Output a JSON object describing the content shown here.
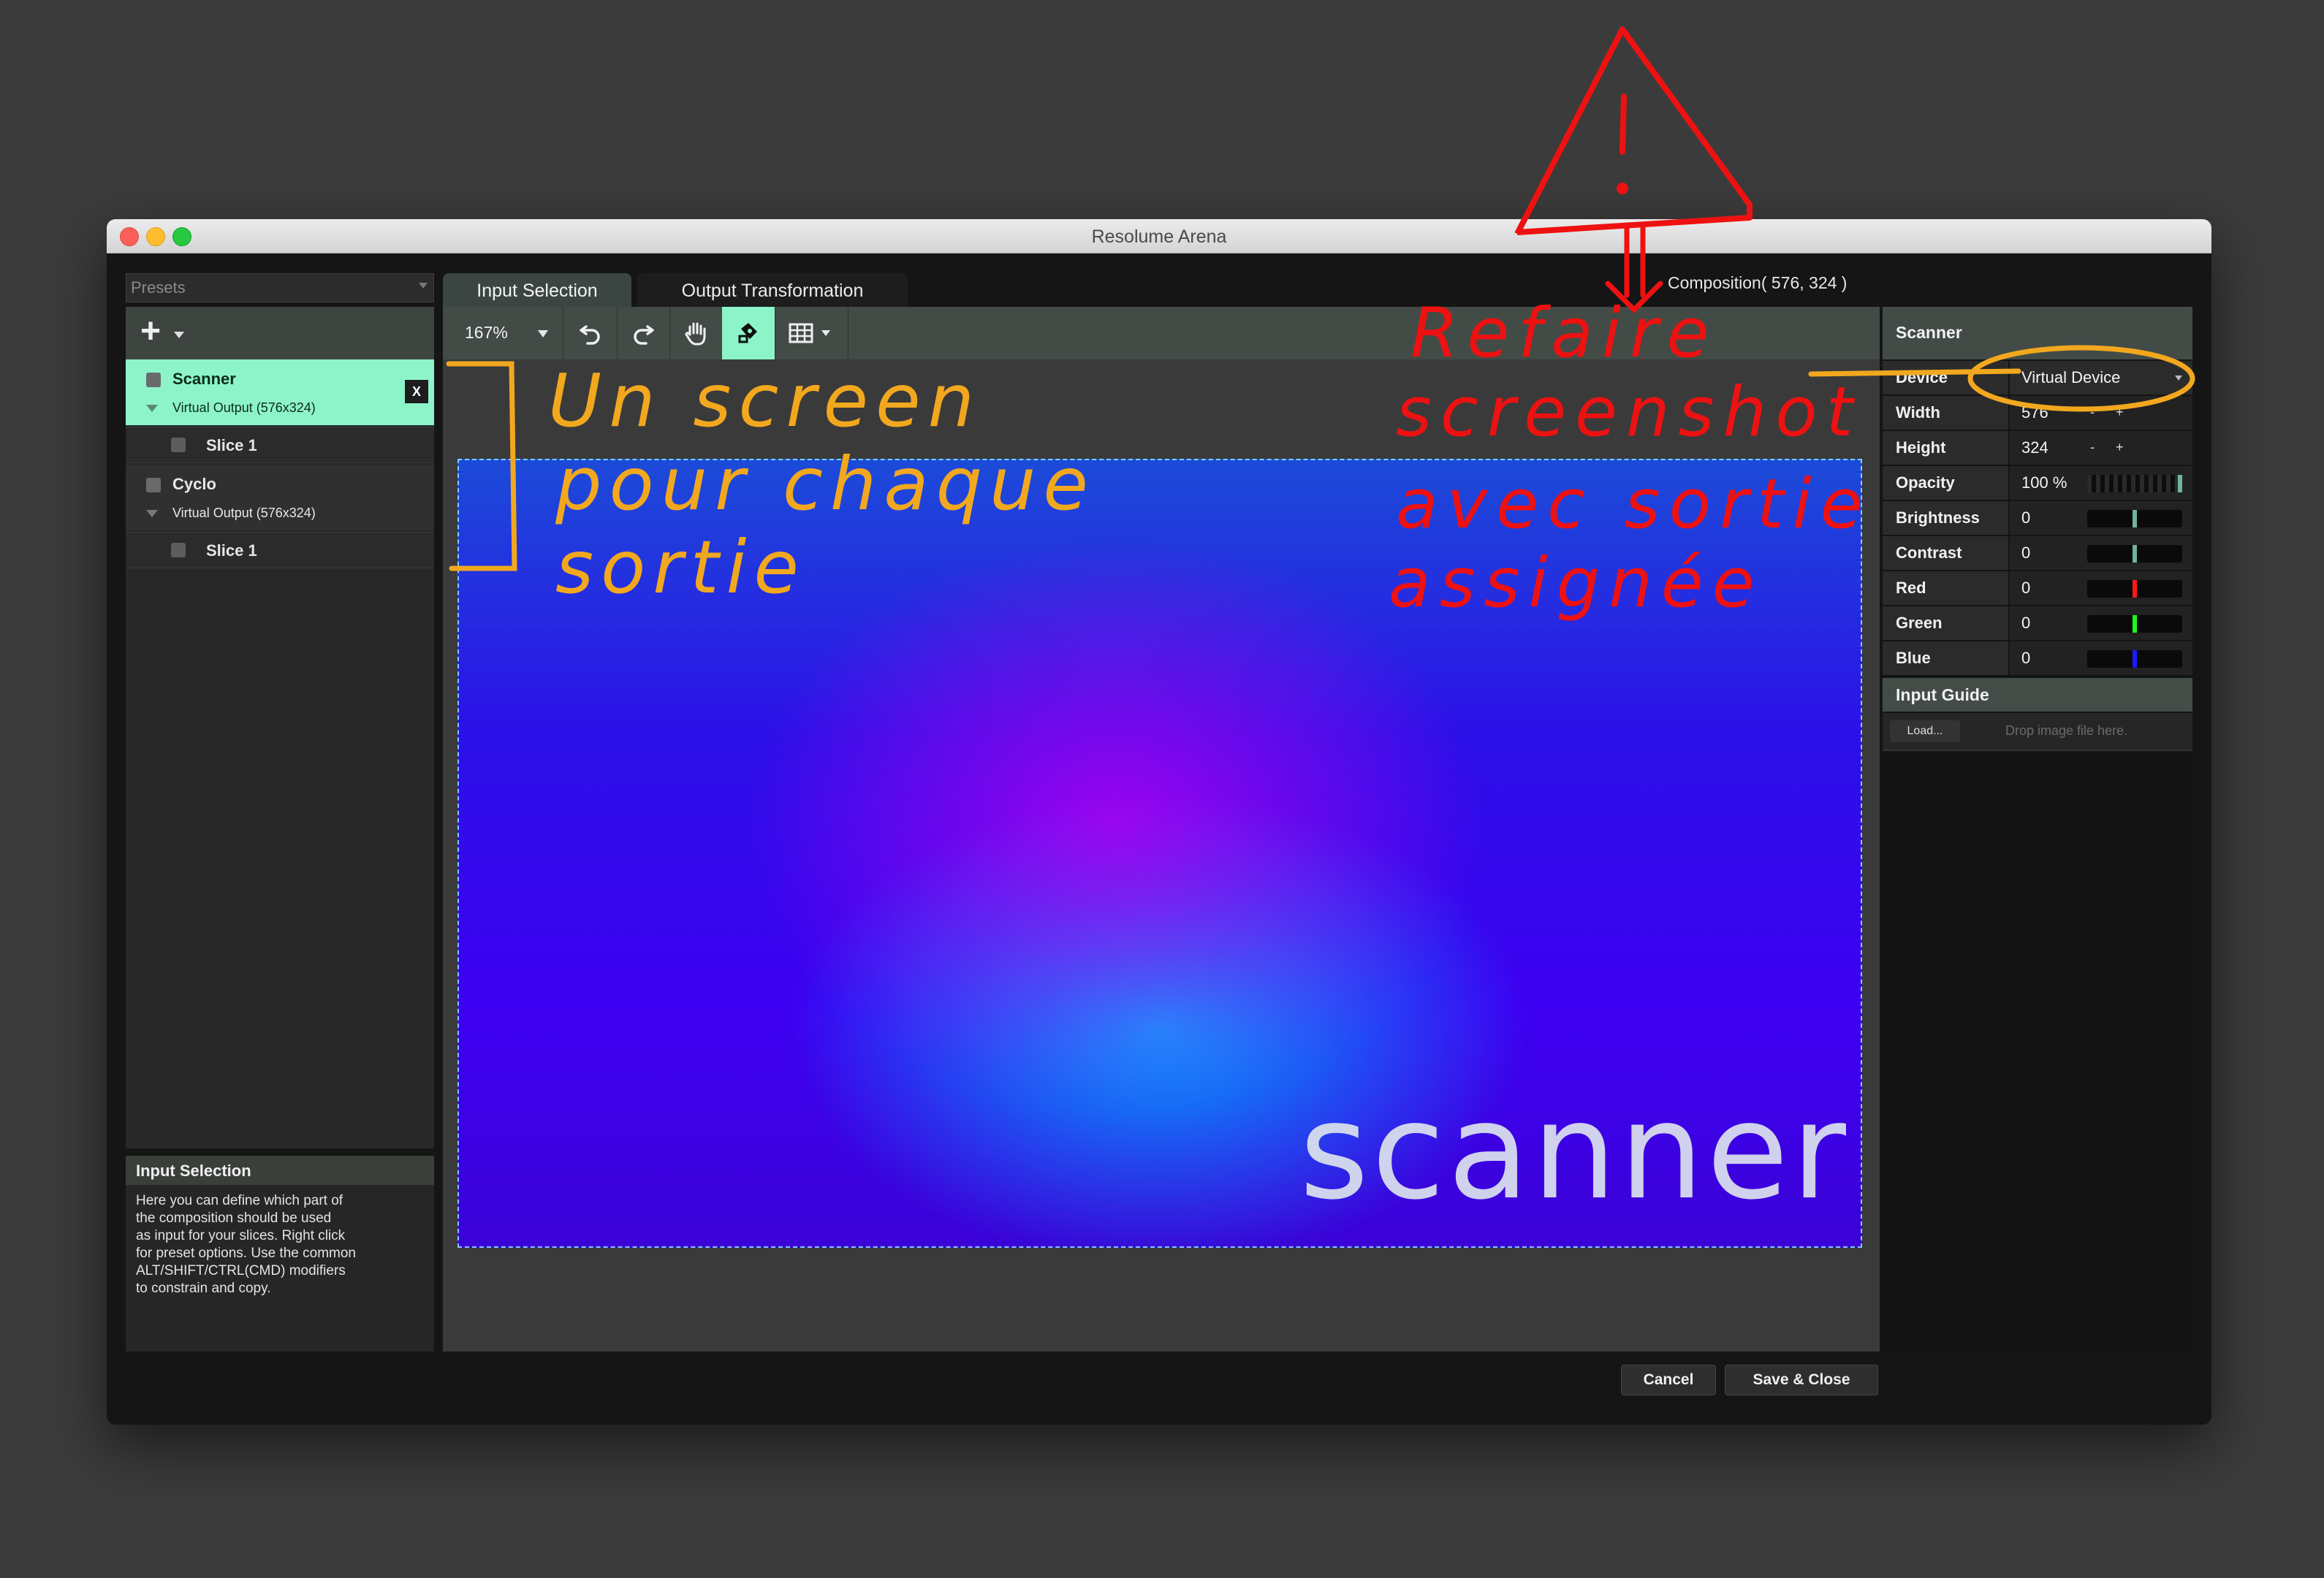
{
  "window": {
    "title": "Resolume Arena"
  },
  "left_panel": {
    "presets_label": "Presets",
    "screens": [
      {
        "name": "Scanner",
        "device": "Virtual Output (576x324)",
        "close_label": "X",
        "slices": [
          "Slice 1"
        ]
      },
      {
        "name": "Cyclo",
        "device": "Virtual Output (576x324)",
        "slices": [
          "Slice 1"
        ]
      }
    ],
    "help": {
      "title": "Input Selection",
      "lines": [
        "Here you can define which part of",
        "the composition should be used",
        "as input for your slices. Right click",
        "for preset options. Use the common",
        "ALT/SHIFT/CTRL(CMD) modifiers",
        "to constrain and copy."
      ]
    }
  },
  "tabs": [
    {
      "label": "Input Selection",
      "active": true
    },
    {
      "label": "Output Transformation",
      "active": false
    }
  ],
  "composition_label": "Composition( 576, 324 )",
  "toolbar": {
    "zoom": "167%",
    "icons": [
      "undo-icon",
      "redo-icon",
      "hand-icon",
      "snap-icon",
      "grid-icon"
    ],
    "accent_color": "#8cf4c8"
  },
  "preview": {
    "caption": "scanner"
  },
  "right_panel": {
    "title": "Scanner",
    "device_label": "Device",
    "device_value": "Virtual Device",
    "width_label": "Width",
    "width_value": "576",
    "height_label": "Height",
    "height_value": "324",
    "stepper_label": "- +",
    "opacity_label": "Opacity",
    "opacity_value": "100 %",
    "opacity_level": 1.0,
    "brightness_label": "Brightness",
    "brightness_value": "0",
    "contrast_label": "Contrast",
    "contrast_value": "0",
    "red_label": "Red",
    "red_value": "0",
    "green_label": "Green",
    "green_value": "0",
    "blue_label": "Blue",
    "blue_value": "0",
    "slider_colors": {
      "brightness": "#6fb3a0",
      "contrast": "#6fb3a0",
      "red": "#ff1a1a",
      "green": "#1aff1a",
      "blue": "#1a1aff"
    },
    "input_guide": {
      "title": "Input Guide",
      "load_label": "Load...",
      "drop_hint": "Drop image file here."
    }
  },
  "buttons": {
    "cancel": "Cancel",
    "save_close": "Save & Close"
  },
  "annotations": {
    "orange": [
      "Un screen",
      "pour chaque",
      "sortie"
    ],
    "red": [
      "Refaire",
      "screenshot",
      "avec sortie",
      "assignée"
    ],
    "colors": {
      "orange": "#f2a81e",
      "red": "#ee1111"
    }
  }
}
